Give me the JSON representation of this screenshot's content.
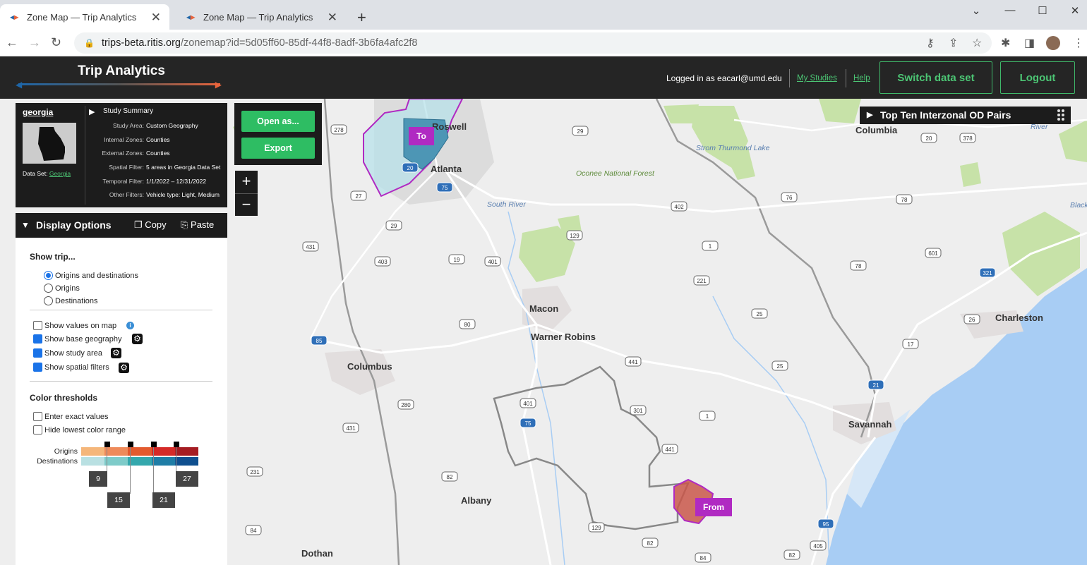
{
  "browser": {
    "tabs": [
      {
        "title": "Zone Map — Trip Analytics",
        "active": true
      },
      {
        "title": "Zone Map — Trip Analytics",
        "active": false
      }
    ],
    "url_domain": "trips-beta.ritis.org",
    "url_path": "/zonemap?id=5d05ff60-85df-44f8-8adf-3b6fa4afc2f8"
  },
  "header": {
    "app_title": "Trip Analytics",
    "logged_in": "Logged in as eacarl@umd.edu",
    "my_studies": "My Studies",
    "help": "Help",
    "switch_label": "Switch data set",
    "logout_label": "Logout"
  },
  "summary": {
    "study_name": "georgia",
    "dataset_label": "Data Set:",
    "dataset_value": "Georgia",
    "section_title": "Study Summary",
    "rows": [
      {
        "label": "Study Area:",
        "value": "Custom Geography"
      },
      {
        "label": "Internal Zones:",
        "value": "Counties"
      },
      {
        "label": "External Zones:",
        "value": "Counties"
      },
      {
        "label": "Spatial Filter:",
        "value": "5 areas in Georgia Data Set"
      },
      {
        "label": "Temporal Filter:",
        "value": "1/1/2022 – 12/31/2022"
      },
      {
        "label": "Other Filters:",
        "value": "Vehicle type: Light, Medium"
      }
    ]
  },
  "actions": {
    "open_as": "Open as...",
    "export": "Export"
  },
  "zoom": {
    "in": "+",
    "out": "−"
  },
  "display": {
    "title": "Display Options",
    "copy": "Copy",
    "paste": "Paste",
    "show_trip_title": "Show trip...",
    "trip_options": [
      {
        "label": "Origins and destinations",
        "selected": true
      },
      {
        "label": "Origins",
        "selected": false
      },
      {
        "label": "Destinations",
        "selected": false
      }
    ],
    "toggles": [
      {
        "label": "Show values on map",
        "checked": false
      },
      {
        "label": "Show base geography",
        "checked": true
      },
      {
        "label": "Show study area",
        "checked": true
      },
      {
        "label": "Show spatial filters",
        "checked": true
      }
    ],
    "color_title": "Color thresholds",
    "color_options": [
      {
        "label": "Enter exact values",
        "checked": false
      },
      {
        "label": "Hide lowest color range",
        "checked": false
      }
    ],
    "legend_origins": "Origins",
    "legend_destinations": "Destinations",
    "origin_colors": [
      "#f5b67a",
      "#ee8a5a",
      "#e35a2e",
      "#d52a28",
      "#a51c22"
    ],
    "destination_colors": [
      "#b9e0e2",
      "#7ecbc9",
      "#34a8ad",
      "#1f7da6",
      "#0f4f8f"
    ],
    "thresholds": [
      "9",
      "15",
      "21",
      "27"
    ]
  },
  "top_ten_title": "Top Ten Interzonal OD Pairs",
  "map": {
    "zone_to": "To",
    "zone_from": "From",
    "cities": [
      "Roswell",
      "Atlanta",
      "Columbia",
      "Macon",
      "Warner Robins",
      "Columbus",
      "Charleston",
      "Savannah",
      "Albany",
      "Dothan"
    ],
    "features": [
      "South River",
      "Oconee National Forest",
      "Strom Thurmond Lake",
      "River",
      "Black River"
    ],
    "route_shields": [
      "278",
      "29",
      "27",
      "29",
      "431",
      "403",
      "19",
      "401",
      "129",
      "402",
      "1",
      "221",
      "25",
      "80",
      "441",
      "401",
      "75",
      "301",
      "1",
      "280",
      "431",
      "231",
      "82",
      "441",
      "129",
      "82",
      "84",
      "84",
      "82",
      "405",
      "95",
      "85",
      "75",
      "20",
      "378",
      "76",
      "78",
      "601",
      "78",
      "321",
      "26",
      "17",
      "21",
      "95",
      "20"
    ]
  },
  "colors": {
    "accent_green": "#2ebd63",
    "zone_magenta": "#b02ac2"
  }
}
